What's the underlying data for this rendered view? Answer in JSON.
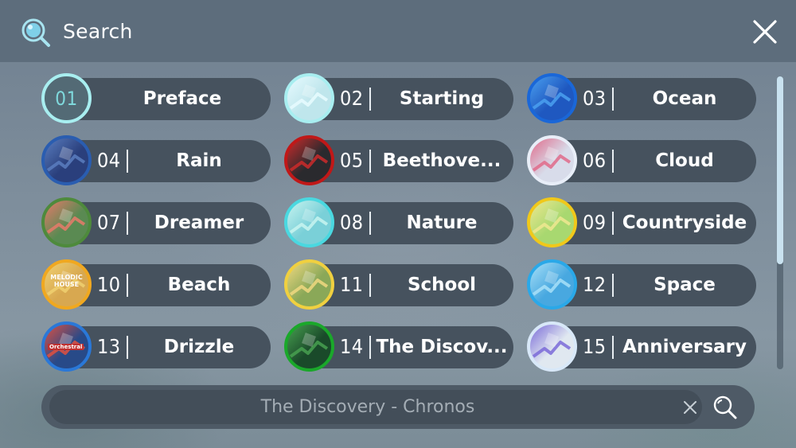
{
  "header": {
    "title": "Search",
    "icon": "search-icon",
    "close_icon": "close-icon"
  },
  "levels": [
    {
      "num": "01",
      "name": "Preface",
      "ring": "#a8eef0",
      "thumb_bg": "#5f7e86",
      "thumb_accent": "#7fd9dc"
    },
    {
      "num": "02",
      "name": "Starting",
      "ring": "#a8eef0",
      "thumb_bg": "#bfe6ec",
      "thumb_accent": "#e8fbff"
    },
    {
      "num": "03",
      "name": "Ocean",
      "ring": "#1a67d8",
      "thumb_bg": "#1f58c0",
      "thumb_accent": "#4aa0f0"
    },
    {
      "num": "04",
      "name": "Rain",
      "ring": "#2a5db0",
      "thumb_bg": "#2a3f7c",
      "thumb_accent": "#5a7ec0"
    },
    {
      "num": "05",
      "name": "Beethove...",
      "ring": "#c01818",
      "thumb_bg": "#2a2a2e",
      "thumb_accent": "#cc2a2a"
    },
    {
      "num": "06",
      "name": "Cloud",
      "ring": "#e8eef8",
      "thumb_bg": "#d8dcea",
      "thumb_accent": "#e06a8a"
    },
    {
      "num": "07",
      "name": "Dreamer",
      "ring": "#4e8a3c",
      "thumb_bg": "#5a8a52",
      "thumb_accent": "#e87a6a"
    },
    {
      "num": "08",
      "name": "Nature",
      "ring": "#4ad8e0",
      "thumb_bg": "#7ad0d8",
      "thumb_accent": "#c8f4f0"
    },
    {
      "num": "09",
      "name": "Countryside",
      "ring": "#f0c81a",
      "thumb_bg": "#a8d870",
      "thumb_accent": "#f0e890"
    },
    {
      "num": "10",
      "name": "Beach",
      "ring": "#f0a820",
      "thumb_bg": "#d8a850",
      "thumb_accent": "#f0d070"
    },
    {
      "num": "11",
      "name": "School",
      "ring": "#f0d040",
      "thumb_bg": "#8aa858",
      "thumb_accent": "#f0d880"
    },
    {
      "num": "12",
      "name": "Space",
      "ring": "#2aa8e8",
      "thumb_bg": "#48a8e0",
      "thumb_accent": "#a8e0f8"
    },
    {
      "num": "13",
      "name": "Drizzle",
      "ring": "#2a78d8",
      "thumb_bg": "#284a88",
      "thumb_accent": "#e05040"
    },
    {
      "num": "14",
      "name": "The Discov...",
      "ring": "#1aa82a",
      "thumb_bg": "#1a4a2a",
      "thumb_accent": "#48a050"
    },
    {
      "num": "15",
      "name": "Anniversary",
      "ring": "#d8e8f8",
      "thumb_bg": "#e0e8f0",
      "thumb_accent": "#7a6ad8"
    }
  ],
  "thumb_text": {
    "melodic": "MELODIC",
    "house": "HOUSE",
    "orchestral": "Orchestral"
  },
  "scrollbar": {
    "position": 0.0,
    "visible_fraction": 0.64
  },
  "search": {
    "value": "The Discovery - Chronos",
    "clear_icon": "close-icon",
    "button_icon": "search-icon"
  },
  "colors": {
    "pill": "#46525e",
    "header": "#5d6d7c",
    "accent": "#7fd9dc"
  }
}
